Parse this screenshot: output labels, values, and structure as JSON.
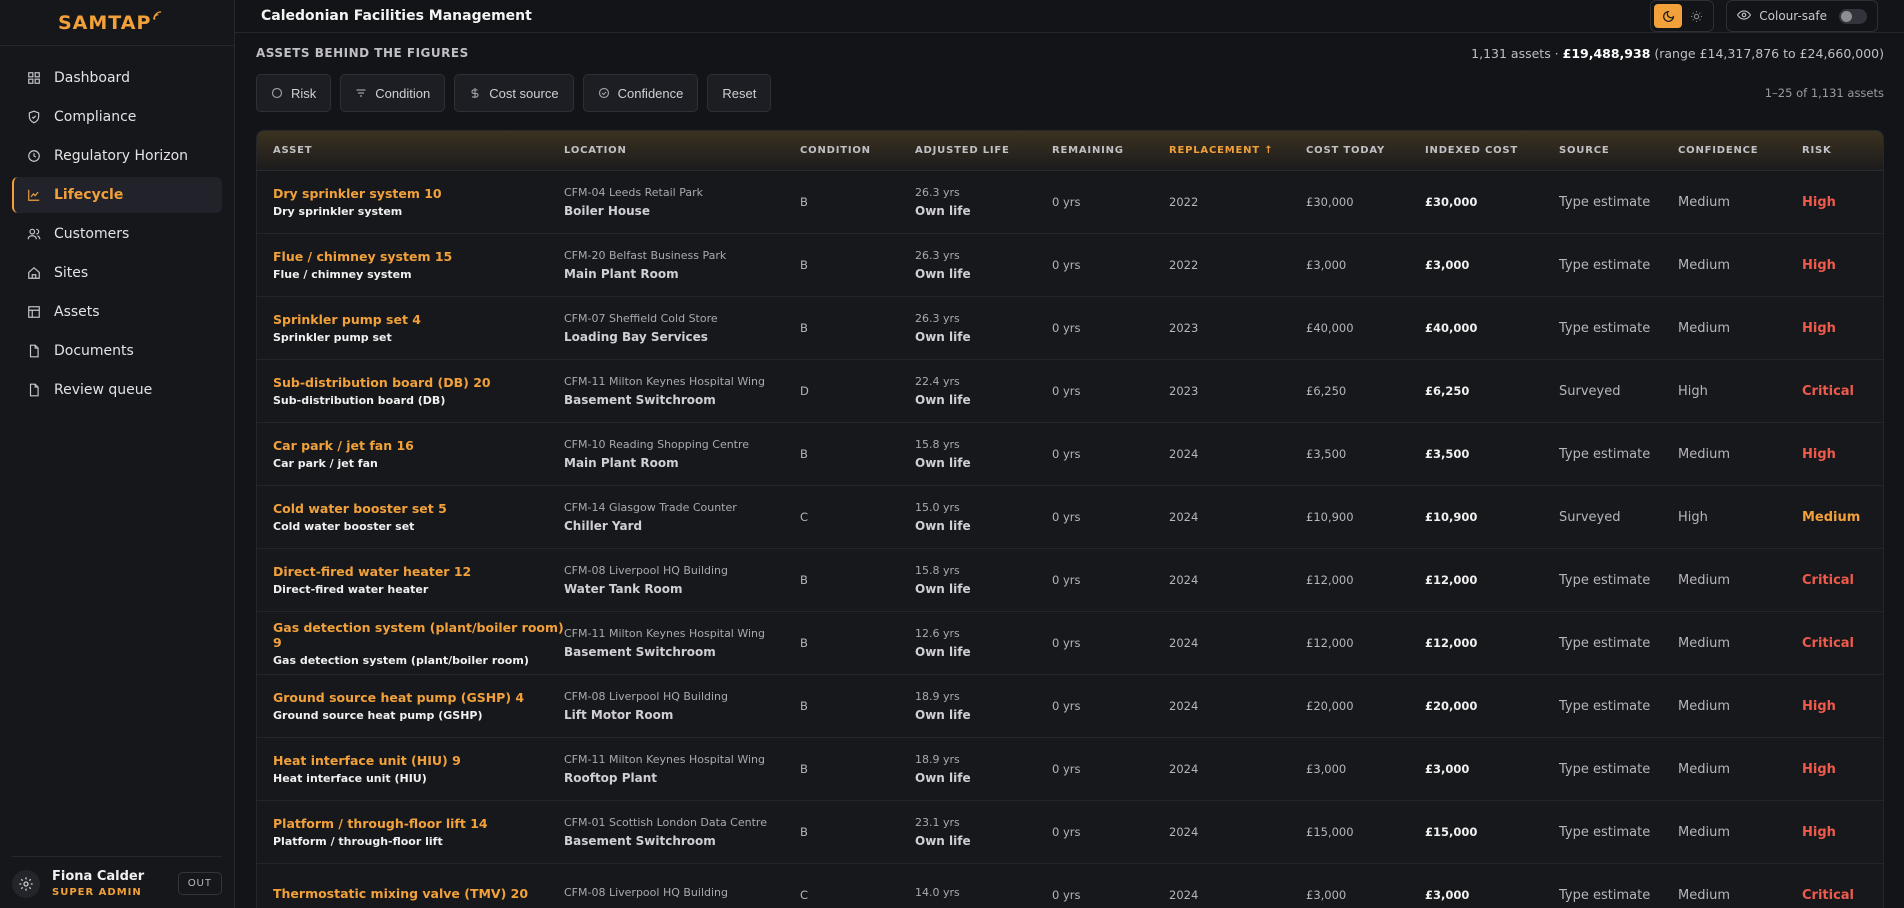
{
  "brand": "SAMTAP",
  "org_name": "Caledonian Facilities Management",
  "nav": [
    {
      "label": "Dashboard",
      "icon": "grid-icon",
      "active": false
    },
    {
      "label": "Compliance",
      "icon": "shield-icon",
      "active": false
    },
    {
      "label": "Regulatory Horizon",
      "icon": "clock-icon",
      "active": false
    },
    {
      "label": "Lifecycle",
      "icon": "chart-line-icon",
      "active": true
    },
    {
      "label": "Customers",
      "icon": "users-icon",
      "active": false
    },
    {
      "label": "Sites",
      "icon": "home-icon",
      "active": false
    },
    {
      "label": "Assets",
      "icon": "table-icon",
      "active": false
    },
    {
      "label": "Documents",
      "icon": "document-icon",
      "active": false
    },
    {
      "label": "Review queue",
      "icon": "document-icon",
      "active": false
    }
  ],
  "user": {
    "name": "Fiona Calder",
    "role": "SUPER ADMIN",
    "out_label": "OUT"
  },
  "topbar": {
    "colour_safe_label": "Colour-safe"
  },
  "section": {
    "title": "ASSETS BEHIND THE FIGURES",
    "summary_prefix": "1,131 assets · ",
    "summary_total": "£19,488,938",
    "summary_range": " (range £14,317,876 to £24,660,000)"
  },
  "filters": [
    {
      "label": "Risk",
      "icon": "circle-icon"
    },
    {
      "label": "Condition",
      "icon": "filter-icon"
    },
    {
      "label": "Cost source",
      "icon": "dollar-icon"
    },
    {
      "label": "Confidence",
      "icon": "check-circle-icon"
    },
    {
      "label": "Reset",
      "icon": ""
    }
  ],
  "pager": "1–25 of 1,131 assets",
  "columns": {
    "asset": "ASSET",
    "location": "LOCATION",
    "condition": "CONDITION",
    "adjusted_life": "ADJUSTED LIFE",
    "remaining": "REMAINING",
    "replacement": "REPLACEMENT ↑",
    "cost_today": "COST TODAY",
    "indexed_cost": "INDEXED COST",
    "source": "SOURCE",
    "confidence": "CONFIDENCE",
    "risk": "RISK"
  },
  "rows": [
    {
      "name": "Dry sprinkler system 10",
      "type": "Dry sprinkler system",
      "site": "CFM-04 Leeds Retail Park",
      "room": "Boiler House",
      "condition": "B",
      "life": "26.3 yrs",
      "life_basis": "Own life",
      "remaining": "0 yrs",
      "replacement": "2022",
      "cost_today": "£30,000",
      "indexed_cost": "£30,000",
      "source": "Type estimate",
      "confidence": "Medium",
      "risk": "High"
    },
    {
      "name": "Flue / chimney system 15",
      "type": "Flue / chimney system",
      "site": "CFM-20 Belfast Business Park",
      "room": "Main Plant Room",
      "condition": "B",
      "life": "26.3 yrs",
      "life_basis": "Own life",
      "remaining": "0 yrs",
      "replacement": "2022",
      "cost_today": "£3,000",
      "indexed_cost": "£3,000",
      "source": "Type estimate",
      "confidence": "Medium",
      "risk": "High"
    },
    {
      "name": "Sprinkler pump set 4",
      "type": "Sprinkler pump set",
      "site": "CFM-07 Sheffield Cold Store",
      "room": "Loading Bay Services",
      "condition": "B",
      "life": "26.3 yrs",
      "life_basis": "Own life",
      "remaining": "0 yrs",
      "replacement": "2023",
      "cost_today": "£40,000",
      "indexed_cost": "£40,000",
      "source": "Type estimate",
      "confidence": "Medium",
      "risk": "High"
    },
    {
      "name": "Sub-distribution board (DB) 20",
      "type": "Sub-distribution board (DB)",
      "site": "CFM-11 Milton Keynes Hospital Wing",
      "room": "Basement Switchroom",
      "condition": "D",
      "life": "22.4 yrs",
      "life_basis": "Own life",
      "remaining": "0 yrs",
      "replacement": "2023",
      "cost_today": "£6,250",
      "indexed_cost": "£6,250",
      "source": "Surveyed",
      "confidence": "High",
      "risk": "Critical"
    },
    {
      "name": "Car park / jet fan 16",
      "type": "Car park / jet fan",
      "site": "CFM-10 Reading Shopping Centre",
      "room": "Main Plant Room",
      "condition": "B",
      "life": "15.8 yrs",
      "life_basis": "Own life",
      "remaining": "0 yrs",
      "replacement": "2024",
      "cost_today": "£3,500",
      "indexed_cost": "£3,500",
      "source": "Type estimate",
      "confidence": "Medium",
      "risk": "High"
    },
    {
      "name": "Cold water booster set 5",
      "type": "Cold water booster set",
      "site": "CFM-14 Glasgow Trade Counter",
      "room": "Chiller Yard",
      "condition": "C",
      "life": "15.0 yrs",
      "life_basis": "Own life",
      "remaining": "0 yrs",
      "replacement": "2024",
      "cost_today": "£10,900",
      "indexed_cost": "£10,900",
      "source": "Surveyed",
      "confidence": "High",
      "risk": "Medium"
    },
    {
      "name": "Direct-fired water heater 12",
      "type": "Direct-fired water heater",
      "site": "CFM-08 Liverpool HQ Building",
      "room": "Water Tank Room",
      "condition": "B",
      "life": "15.8 yrs",
      "life_basis": "Own life",
      "remaining": "0 yrs",
      "replacement": "2024",
      "cost_today": "£12,000",
      "indexed_cost": "£12,000",
      "source": "Type estimate",
      "confidence": "Medium",
      "risk": "Critical"
    },
    {
      "name": "Gas detection system (plant/boiler room) 9",
      "type": "Gas detection system (plant/boiler room)",
      "site": "CFM-11 Milton Keynes Hospital Wing",
      "room": "Basement Switchroom",
      "condition": "B",
      "life": "12.6 yrs",
      "life_basis": "Own life",
      "remaining": "0 yrs",
      "replacement": "2024",
      "cost_today": "£12,000",
      "indexed_cost": "£12,000",
      "source": "Type estimate",
      "confidence": "Medium",
      "risk": "Critical"
    },
    {
      "name": "Ground source heat pump (GSHP) 4",
      "type": "Ground source heat pump (GSHP)",
      "site": "CFM-08 Liverpool HQ Building",
      "room": "Lift Motor Room",
      "condition": "B",
      "life": "18.9 yrs",
      "life_basis": "Own life",
      "remaining": "0 yrs",
      "replacement": "2024",
      "cost_today": "£20,000",
      "indexed_cost": "£20,000",
      "source": "Type estimate",
      "confidence": "Medium",
      "risk": "High"
    },
    {
      "name": "Heat interface unit (HIU) 9",
      "type": "Heat interface unit (HIU)",
      "site": "CFM-11 Milton Keynes Hospital Wing",
      "room": "Rooftop Plant",
      "condition": "B",
      "life": "18.9 yrs",
      "life_basis": "Own life",
      "remaining": "0 yrs",
      "replacement": "2024",
      "cost_today": "£3,000",
      "indexed_cost": "£3,000",
      "source": "Type estimate",
      "confidence": "Medium",
      "risk": "High"
    },
    {
      "name": "Platform / through-floor lift 14",
      "type": "Platform / through-floor lift",
      "site": "CFM-01 Scottish London Data Centre",
      "room": "Basement Switchroom",
      "condition": "B",
      "life": "23.1 yrs",
      "life_basis": "Own life",
      "remaining": "0 yrs",
      "replacement": "2024",
      "cost_today": "£15,000",
      "indexed_cost": "£15,000",
      "source": "Type estimate",
      "confidence": "Medium",
      "risk": "High"
    },
    {
      "name": "Thermostatic mixing valve (TMV) 20",
      "type": "",
      "site": "CFM-08 Liverpool HQ Building",
      "room": "",
      "condition": "C",
      "life": "14.0 yrs",
      "life_basis": "",
      "remaining": "0 yrs",
      "replacement": "2024",
      "cost_today": "£3,000",
      "indexed_cost": "£3,000",
      "source": "Type estimate",
      "confidence": "Medium",
      "risk": "Critical"
    }
  ]
}
